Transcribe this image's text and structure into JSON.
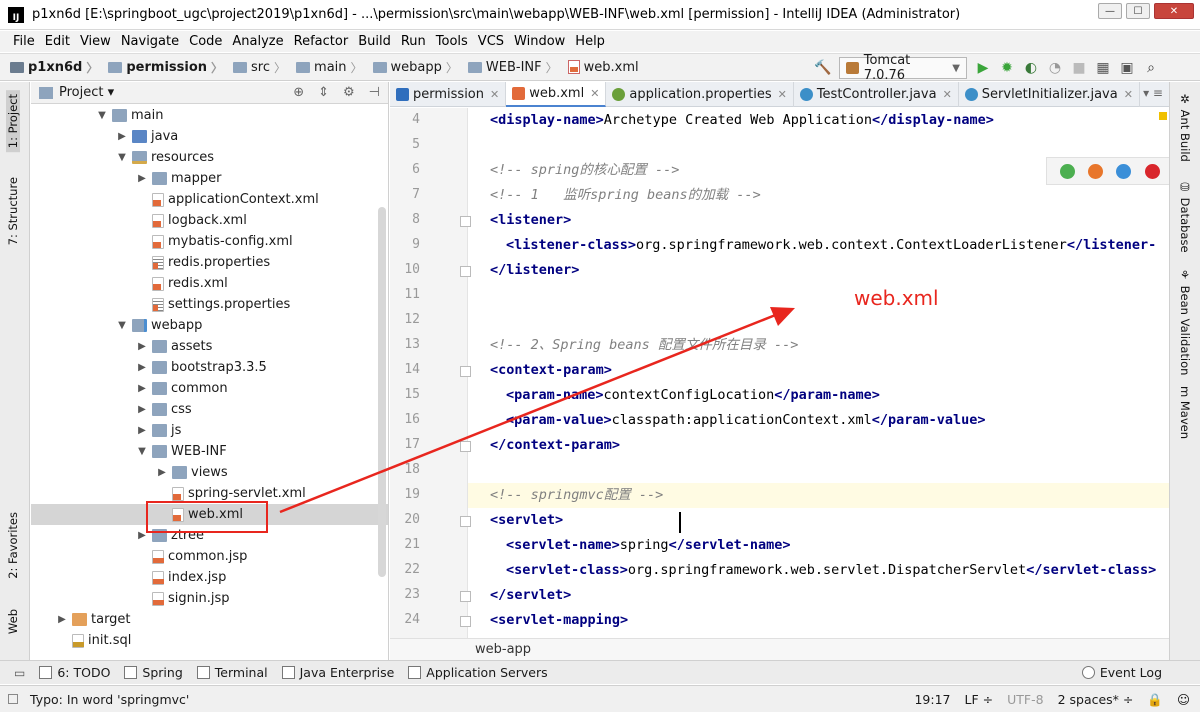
{
  "window": {
    "title": "p1xn6d [E:\\springboot_ugc\\project2019\\p1xn6d] - ...\\permission\\src\\main\\webapp\\WEB-INF\\web.xml [permission] - IntelliJ IDEA (Administrator)",
    "app_icon_text": "IJ",
    "minimize": "—",
    "maximize": "☐",
    "close": "✕"
  },
  "menu": [
    "File",
    "Edit",
    "View",
    "Navigate",
    "Code",
    "Analyze",
    "Refactor",
    "Build",
    "Run",
    "Tools",
    "VCS",
    "Window",
    "Help"
  ],
  "navbar": {
    "crumbs": [
      "p1xn6d",
      "permission",
      "src",
      "main",
      "webapp",
      "WEB-INF",
      "web.xml"
    ],
    "run_config": "Tomcat 7.0.76"
  },
  "left_stripe": {
    "project": "1: Project",
    "structure": "7: Structure",
    "favorites": "2: Favorites",
    "web": "Web"
  },
  "right_stripe": {
    "ant": "Ant Build",
    "database": "Database",
    "bean": "Bean Validation",
    "maven": "Maven"
  },
  "project_panel": {
    "title": "Project ▾",
    "tree": [
      {
        "label": "main",
        "indent": 3,
        "arrow": "down",
        "icon": "folder"
      },
      {
        "label": "java",
        "indent": 4,
        "arrow": "right",
        "icon": "folder-src"
      },
      {
        "label": "resources",
        "indent": 4,
        "arrow": "down",
        "icon": "folder-res"
      },
      {
        "label": "mapper",
        "indent": 5,
        "arrow": "right",
        "icon": "folder"
      },
      {
        "label": "applicationContext.xml",
        "indent": 5,
        "arrow": "",
        "icon": "xml"
      },
      {
        "label": "logback.xml",
        "indent": 5,
        "arrow": "",
        "icon": "xml"
      },
      {
        "label": "mybatis-config.xml",
        "indent": 5,
        "arrow": "",
        "icon": "xml"
      },
      {
        "label": "redis.properties",
        "indent": 5,
        "arrow": "",
        "icon": "props"
      },
      {
        "label": "redis.xml",
        "indent": 5,
        "arrow": "",
        "icon": "xml"
      },
      {
        "label": "settings.properties",
        "indent": 5,
        "arrow": "",
        "icon": "props"
      },
      {
        "label": "webapp",
        "indent": 4,
        "arrow": "down",
        "icon": "folder-web"
      },
      {
        "label": "assets",
        "indent": 5,
        "arrow": "right",
        "icon": "folder"
      },
      {
        "label": "bootstrap3.3.5",
        "indent": 5,
        "arrow": "right",
        "icon": "folder"
      },
      {
        "label": "common",
        "indent": 5,
        "arrow": "right",
        "icon": "folder"
      },
      {
        "label": "css",
        "indent": 5,
        "arrow": "right",
        "icon": "folder"
      },
      {
        "label": "js",
        "indent": 5,
        "arrow": "right",
        "icon": "folder"
      },
      {
        "label": "WEB-INF",
        "indent": 5,
        "arrow": "down",
        "icon": "folder"
      },
      {
        "label": "views",
        "indent": 6,
        "arrow": "right",
        "icon": "folder"
      },
      {
        "label": "spring-servlet.xml",
        "indent": 6,
        "arrow": "",
        "icon": "xml"
      },
      {
        "label": "web.xml",
        "indent": 6,
        "arrow": "",
        "icon": "xml",
        "selected": true
      },
      {
        "label": "ztree",
        "indent": 5,
        "arrow": "right",
        "icon": "folder"
      },
      {
        "label": "common.jsp",
        "indent": 5,
        "arrow": "",
        "icon": "jsp"
      },
      {
        "label": "index.jsp",
        "indent": 5,
        "arrow": "",
        "icon": "jsp"
      },
      {
        "label": "signin.jsp",
        "indent": 5,
        "arrow": "",
        "icon": "jsp"
      },
      {
        "label": "target",
        "indent": 1,
        "arrow": "right",
        "icon": "folder-orange"
      },
      {
        "label": "init.sql",
        "indent": 1,
        "arrow": "",
        "icon": "sql"
      }
    ]
  },
  "editor": {
    "tabs": [
      {
        "label": "permission",
        "icon": "m",
        "active": false
      },
      {
        "label": "web.xml",
        "icon": "xmlf",
        "active": true
      },
      {
        "label": "application.properties",
        "icon": "leaf",
        "active": false
      },
      {
        "label": "TestController.java",
        "icon": "cls",
        "active": false
      },
      {
        "label": "ServletInitializer.java",
        "icon": "cls",
        "active": false
      }
    ],
    "tabs_menu": "▾  ≡",
    "lines": [
      {
        "n": "4",
        "parts": [
          {
            "t": "tag",
            "v": "<display-name>"
          },
          {
            "t": "txt",
            "v": "Archetype Created Web Application"
          },
          {
            "t": "tag",
            "v": "</display-name>"
          }
        ],
        "indent": 1
      },
      {
        "n": "5",
        "parts": [],
        "indent": 0
      },
      {
        "n": "6",
        "parts": [
          {
            "t": "cmt",
            "v": "<!-- spring的核心配置 -->"
          }
        ],
        "indent": 1
      },
      {
        "n": "7",
        "parts": [
          {
            "t": "cmt",
            "v": "<!-- 1   监听spring beans的加载 -->"
          }
        ],
        "indent": 1
      },
      {
        "n": "8",
        "parts": [
          {
            "t": "tag",
            "v": "<listener>"
          }
        ],
        "indent": 1
      },
      {
        "n": "9",
        "parts": [
          {
            "t": "tag",
            "v": "<listener-class>"
          },
          {
            "t": "txt",
            "v": "org.springframework.web.context.ContextLoaderListener"
          },
          {
            "t": "tag",
            "v": "</listener-"
          }
        ],
        "indent": 2
      },
      {
        "n": "10",
        "parts": [
          {
            "t": "tag",
            "v": "</listener>"
          }
        ],
        "indent": 1
      },
      {
        "n": "11",
        "parts": [],
        "indent": 0
      },
      {
        "n": "12",
        "parts": [],
        "indent": 0
      },
      {
        "n": "13",
        "parts": [
          {
            "t": "cmt",
            "v": "<!-- 2、Spring beans 配置文件所在目录 -->"
          }
        ],
        "indent": 1
      },
      {
        "n": "14",
        "parts": [
          {
            "t": "tag",
            "v": "<context-param>"
          }
        ],
        "indent": 1
      },
      {
        "n": "15",
        "parts": [
          {
            "t": "tag",
            "v": "<param-name>"
          },
          {
            "t": "txt",
            "v": "contextConfigLocation"
          },
          {
            "t": "tag",
            "v": "</param-name>"
          }
        ],
        "indent": 2
      },
      {
        "n": "16",
        "parts": [
          {
            "t": "tag",
            "v": "<param-value>"
          },
          {
            "t": "txt",
            "v": "classpath:applicationContext.xml"
          },
          {
            "t": "tag",
            "v": "</param-value>"
          }
        ],
        "indent": 2
      },
      {
        "n": "17",
        "parts": [
          {
            "t": "tag",
            "v": "</context-param>"
          }
        ],
        "indent": 1
      },
      {
        "n": "18",
        "parts": [],
        "indent": 0
      },
      {
        "n": "19",
        "parts": [
          {
            "t": "cmt",
            "v": "<!-- springmvc配置 -->"
          }
        ],
        "indent": 1,
        "current": true
      },
      {
        "n": "20",
        "parts": [
          {
            "t": "tag",
            "v": "<servlet>"
          }
        ],
        "indent": 1
      },
      {
        "n": "21",
        "parts": [
          {
            "t": "tag",
            "v": "<servlet-name>"
          },
          {
            "t": "txt",
            "v": "spring"
          },
          {
            "t": "tag",
            "v": "</servlet-name>"
          }
        ],
        "indent": 2
      },
      {
        "n": "22",
        "parts": [
          {
            "t": "tag",
            "v": "<servlet-class>"
          },
          {
            "t": "txt",
            "v": "org.springframework.web.servlet.DispatcherServlet"
          },
          {
            "t": "tag",
            "v": "</servlet-class>"
          }
        ],
        "indent": 2
      },
      {
        "n": "23",
        "parts": [
          {
            "t": "tag",
            "v": "</servlet>"
          }
        ],
        "indent": 1
      },
      {
        "n": "24",
        "parts": [
          {
            "t": "tag",
            "v": "<servlet-mapping>"
          }
        ],
        "indent": 1
      }
    ],
    "browsers": [
      {
        "name": "chrome-icon",
        "color": "#4caf50"
      },
      {
        "name": "firefox-icon",
        "color": "#e8762b"
      },
      {
        "name": "safari-icon",
        "color": "#3b8fd8"
      },
      {
        "name": "opera-icon",
        "color": "#d9262c"
      },
      {
        "name": "ie-icon",
        "color": "#2a8ad8"
      },
      {
        "name": "edge-icon",
        "color": "#1f6fc4"
      }
    ],
    "breadcrumb": "web-app"
  },
  "annotation": {
    "label": "web.xml",
    "color": "#e8261e"
  },
  "bottom_tools": [
    {
      "label": "6: TODO",
      "name": "todo"
    },
    {
      "label": "Spring",
      "name": "spring"
    },
    {
      "label": "Terminal",
      "name": "terminal"
    },
    {
      "label": "Java Enterprise",
      "name": "java-enterprise"
    },
    {
      "label": "Application Servers",
      "name": "application-servers"
    }
  ],
  "event_log": "Event Log",
  "status": {
    "message": "Typo: In word 'springmvc'",
    "position": "19:17",
    "line_sep": "LF ÷",
    "encoding": "UTF-8",
    "indent": "2 spaces* ÷"
  }
}
